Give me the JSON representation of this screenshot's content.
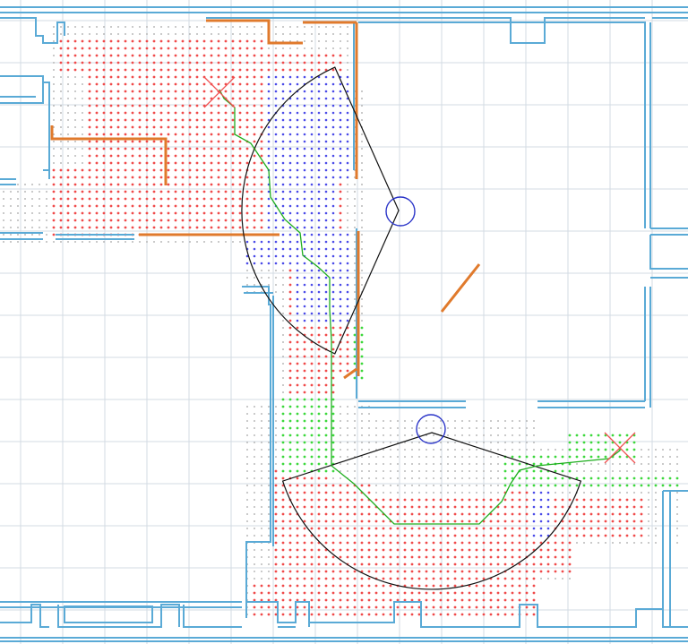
{
  "view": {
    "title": "",
    "grid_visible": true
  },
  "colors": {
    "background": "#ffffff",
    "grid": "#d3dbe3",
    "walls": "#5aaad6",
    "obstacles": "#e07a2c",
    "samples_gray": "#b9b9b9",
    "samples_red": "#f04a4a",
    "samples_blue": "#4a4ae8",
    "samples_green": "#3cd83c",
    "path": "#1fae1f",
    "robot_circle": "#2a34c8",
    "sensor_fov": "#111111",
    "goal_cross": "#f05050"
  },
  "legend": {
    "robots": [
      {
        "id": "robot-upper",
        "icon": "circle"
      },
      {
        "id": "robot-lower",
        "icon": "circle"
      }
    ],
    "goals": [
      {
        "id": "goal-upper-left",
        "icon": "x-cross"
      },
      {
        "id": "goal-lower-right",
        "icon": "x-cross"
      }
    ]
  }
}
